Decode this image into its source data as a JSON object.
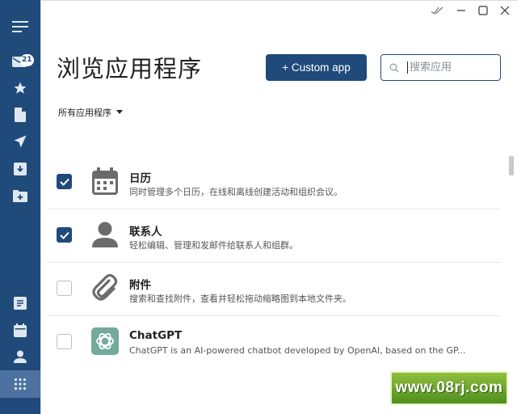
{
  "sidebar": {
    "mail_badge": "21",
    "items": [
      {
        "name": "menu"
      },
      {
        "name": "mail"
      },
      {
        "name": "favorites"
      },
      {
        "name": "documents"
      },
      {
        "name": "sent"
      },
      {
        "name": "archive"
      },
      {
        "name": "folder-add"
      },
      {
        "name": "notes"
      },
      {
        "name": "calendar"
      },
      {
        "name": "contacts"
      },
      {
        "name": "apps",
        "active": true
      }
    ]
  },
  "header": {
    "title": "浏览应用程序",
    "custom_app_label": "+ Custom app",
    "search_placeholder": "搜索应用"
  },
  "filter": {
    "label": "所有应用程序"
  },
  "apps": [
    {
      "name": "日历",
      "description": "同时管理多个日历，在线和离线创建活动和组织会议。",
      "checked": true,
      "icon": "calendar-icon"
    },
    {
      "name": "联系人",
      "description": "轻松编辑、管理和发邮件给联系人和组群。",
      "checked": true,
      "icon": "contact-person-icon"
    },
    {
      "name": "附件",
      "description": "搜索和查找附件，查看并轻松拖动缩略图到本地文件夹。",
      "checked": false,
      "icon": "paperclip-icon"
    },
    {
      "name": "ChatGPT",
      "description": "ChatGPT is an AI-powered chatbot developed by OpenAI, based on the GP...",
      "checked": false,
      "icon": "chatgpt-logo-icon"
    }
  ],
  "watermark": "www.08rj.com",
  "colors": {
    "sidebar": "#1f4a7a",
    "sidebar_active": "#4d71a0",
    "accent": "#1f4a7a",
    "chatgpt": "#74aa9c"
  }
}
